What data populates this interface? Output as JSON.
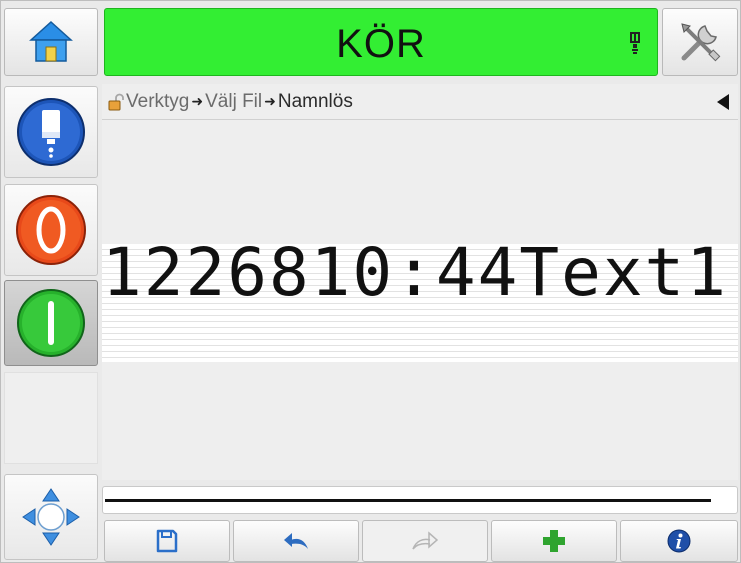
{
  "status": {
    "text": "KÖR",
    "color": "#33ee33"
  },
  "breadcrumb": {
    "part1": "Verktyg",
    "part2": "Välj Fil",
    "part3": "Namnlös"
  },
  "message": {
    "text": "1226810:44Text1"
  },
  "icons": {
    "home": "home-icon",
    "ink": "ink-bottle-icon",
    "tools": "tools-icon",
    "stop": "stop-icon",
    "start": "start-icon",
    "nav": "navigation-arrows-icon",
    "save": "save-icon",
    "undo": "undo-icon",
    "redo": "redo-icon",
    "add": "add-icon",
    "info": "info-icon",
    "lock": "unlocked-padlock-icon"
  }
}
